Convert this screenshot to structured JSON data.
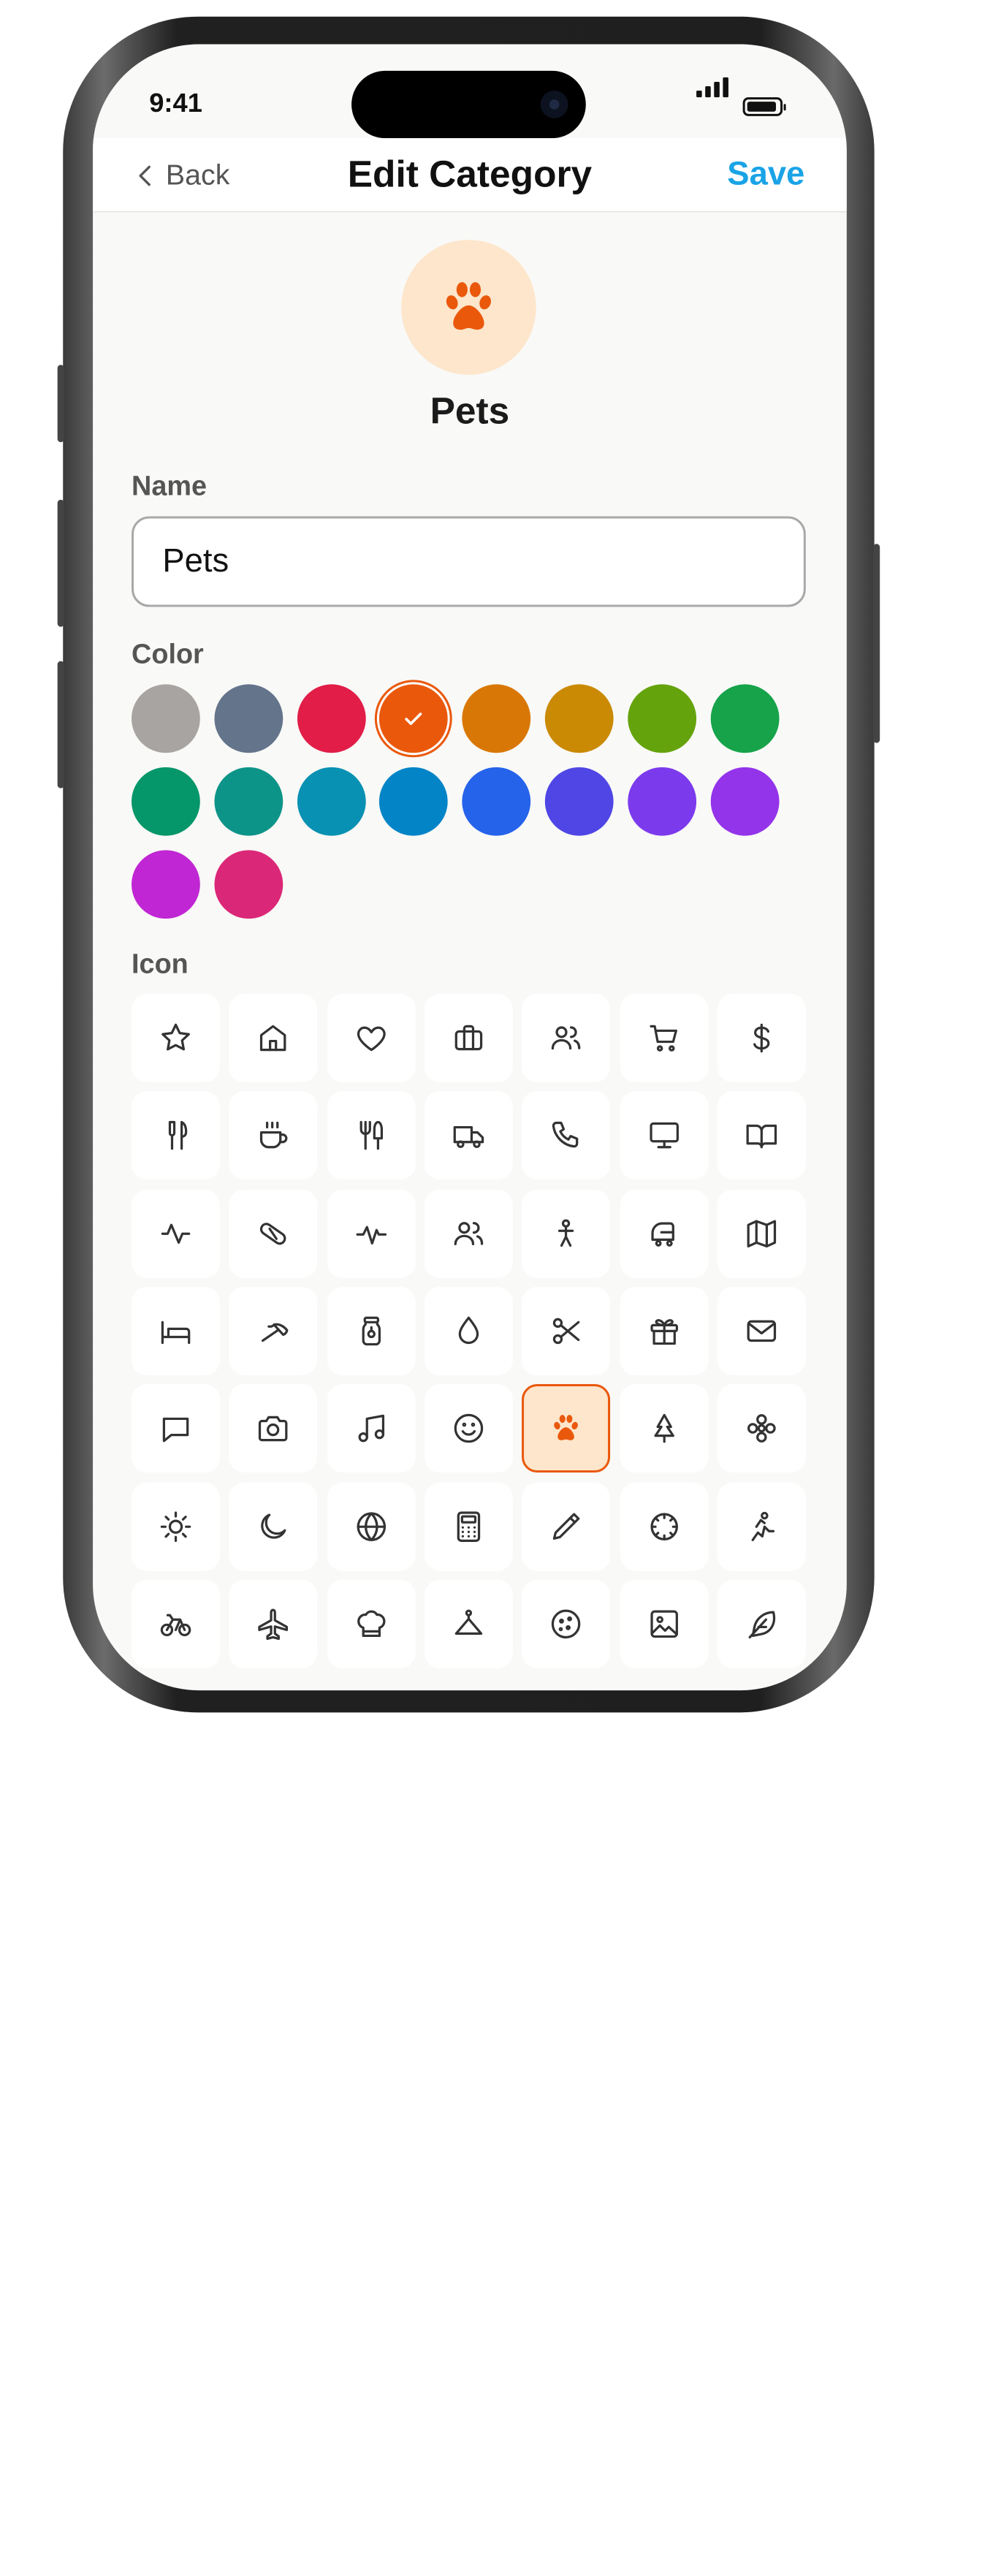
{
  "status": {
    "time": "9:41"
  },
  "nav": {
    "back_label": "Back",
    "title": "Edit Category",
    "save_label": "Save"
  },
  "preview": {
    "name": "Pets",
    "icon": "paw-icon",
    "color": "#EA580C",
    "bg": "#FDE6CC"
  },
  "form": {
    "name_label": "Name",
    "name_value": "Pets",
    "color_label": "Color",
    "icon_label": "Icon"
  },
  "colors": [
    "#A8A4A1",
    "#64748B",
    "#E11D48",
    "#EA580C",
    "#D97706",
    "#CA8A04",
    "#65A30D",
    "#16A34A",
    "#059669",
    "#0D9488",
    "#0891B2",
    "#0284C7",
    "#2563EB",
    "#4F46E5",
    "#7C3AED",
    "#9333EA",
    "#C026D3",
    "#DB2777"
  ],
  "selected_color": "#EA580C",
  "icons": [
    "star",
    "home",
    "heart",
    "briefcase",
    "users",
    "shopping-cart",
    "dollar-sign",
    "utensils",
    "coffee",
    "fork-knife",
    "truck",
    "phone",
    "monitor",
    "book-open",
    "activity",
    "pill",
    "heartbeat",
    "people",
    "child",
    "car",
    "map",
    "bed",
    "umbrella",
    "jar",
    "droplet",
    "scissors",
    "gift",
    "mail",
    "message",
    "camera",
    "music",
    "smile",
    "paw",
    "tree",
    "flower",
    "sun",
    "moon",
    "globe",
    "calculator",
    "pencil",
    "dial",
    "running",
    "bicycle",
    "airplane",
    "chef-hat",
    "hanger",
    "cookie",
    "image",
    "feather"
  ],
  "selected_icon": "paw"
}
